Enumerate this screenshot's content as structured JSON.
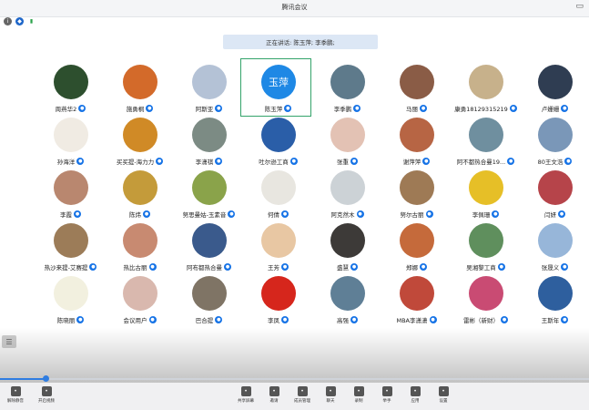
{
  "window": {
    "title": "腾讯会议"
  },
  "status": {
    "speaking_text": "正在讲话: 陈玉萍; 李季鹏;"
  },
  "participants": [
    {
      "name": "周燕华2",
      "color": "#2d4f2e"
    },
    {
      "name": "施勇桐",
      "color": "#d36a2a"
    },
    {
      "name": "阿斯亚",
      "color": "#b4c2d6"
    },
    {
      "name": "陈玉萍",
      "color": "#1e88e5",
      "avatar_text": "玉萍",
      "active": true
    },
    {
      "name": "李季鹏",
      "color": "#5e7a8b"
    },
    {
      "name": "马丽",
      "color": "#8a5c46"
    },
    {
      "name": "康勇18129315219",
      "color": "#c7b18b"
    },
    {
      "name": "卢姗姗",
      "color": "#2f3d52"
    },
    {
      "name": "孙海洋",
      "color": "#f0ebe3"
    },
    {
      "name": "买买提-海力力",
      "color": "#d08a26"
    },
    {
      "name": "李潇祺",
      "color": "#7c8b84"
    },
    {
      "name": "吐尔逊工商",
      "color": "#2a5ea8"
    },
    {
      "name": "张重",
      "color": "#e3c2b4"
    },
    {
      "name": "谢萍萍",
      "color": "#b76544"
    },
    {
      "name": "阿不都热合曼19...",
      "color": "#6f8f9f"
    },
    {
      "name": "80王文浩",
      "color": "#7a97b8"
    },
    {
      "name": "李霞",
      "color": "#b9876f"
    },
    {
      "name": "陈炜",
      "color": "#c49b3a"
    },
    {
      "name": "努思曼姑-玉素音",
      "color": "#8aa34a"
    },
    {
      "name": "何倩",
      "color": "#e8e6e0"
    },
    {
      "name": "阿克然木",
      "color": "#ccd2d6"
    },
    {
      "name": "努尔古丽",
      "color": "#9e7a55"
    },
    {
      "name": "李佩珊",
      "color": "#e6bf27"
    },
    {
      "name": "闫妍",
      "color": "#b6444a"
    },
    {
      "name": "热沙来提-艾赛提",
      "color": "#9c7c58"
    },
    {
      "name": "热比古丽",
      "color": "#c88a71"
    },
    {
      "name": "阿布都热合曼",
      "color": "#3a5a8c"
    },
    {
      "name": "王芳",
      "color": "#e8c7a3"
    },
    {
      "name": "盛慧",
      "color": "#3d3a38"
    },
    {
      "name": "郑娜",
      "color": "#c56a3b"
    },
    {
      "name": "吴湘黎工商",
      "color": "#5f8f5d"
    },
    {
      "name": "张晟义",
      "color": "#97b6d9"
    },
    {
      "name": "陈晓丽",
      "color": "#f2f0df"
    },
    {
      "name": "会议用户",
      "color": "#d9b8ae"
    },
    {
      "name": "巴合提",
      "color": "#7f7465"
    },
    {
      "name": "李凤",
      "color": "#d6261c"
    },
    {
      "name": "高强",
      "color": "#5f7f96"
    },
    {
      "name": "MBA李潇潇",
      "color": "#c0493a"
    },
    {
      "name": "雷彬（新财）",
      "color": "#c94b73"
    },
    {
      "name": "王斯年",
      "color": "#2e5f9e"
    }
  ],
  "toolbar": {
    "items": [
      {
        "label": "解除静音",
        "icon": "mic-icon"
      },
      {
        "label": "开启视频",
        "icon": "camera-icon"
      },
      {
        "label": "共享屏幕",
        "icon": "share-icon"
      },
      {
        "label": "邀请",
        "icon": "invite-icon"
      },
      {
        "label": "成员管理",
        "icon": "members-icon"
      },
      {
        "label": "聊天",
        "icon": "chat-icon"
      },
      {
        "label": "录制",
        "icon": "record-icon"
      },
      {
        "label": "举手",
        "icon": "hand-icon"
      },
      {
        "label": "应用",
        "icon": "apps-icon"
      },
      {
        "label": "设置",
        "icon": "gear-icon"
      }
    ]
  }
}
